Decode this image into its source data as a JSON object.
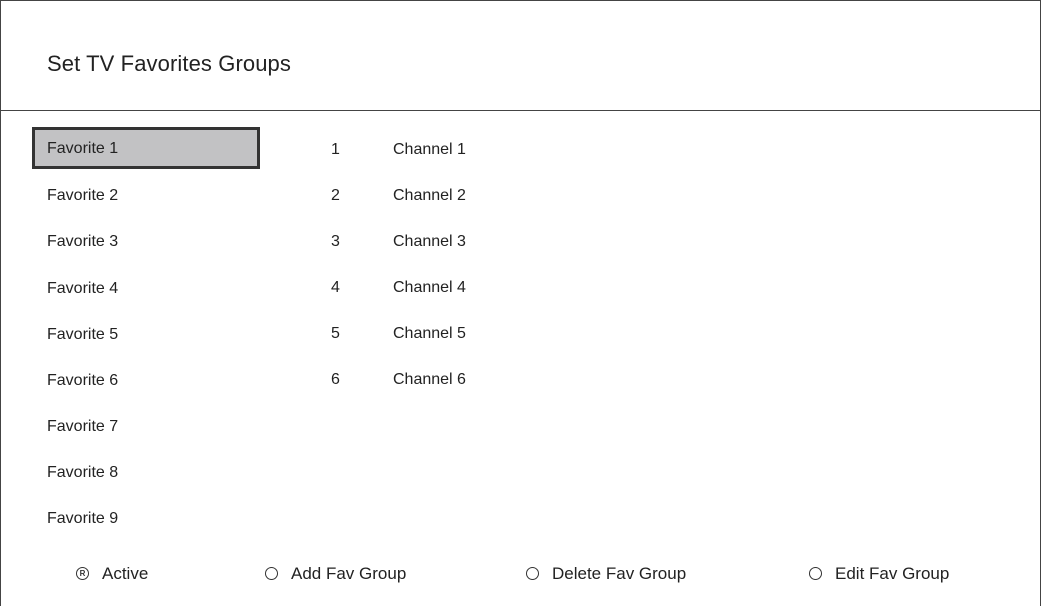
{
  "header": {
    "title": "Set TV Favorites Groups"
  },
  "favorites": [
    {
      "label": "Favorite 1",
      "selected": true
    },
    {
      "label": "Favorite 2",
      "selected": false
    },
    {
      "label": "Favorite 3",
      "selected": false
    },
    {
      "label": "Favorite 4",
      "selected": false
    },
    {
      "label": "Favorite 5",
      "selected": false
    },
    {
      "label": "Favorite 6",
      "selected": false
    },
    {
      "label": "Favorite 7",
      "selected": false
    },
    {
      "label": "Favorite 8",
      "selected": false
    },
    {
      "label": "Favorite 9",
      "selected": false
    }
  ],
  "channels": [
    {
      "number": "1",
      "name": "Channel 1"
    },
    {
      "number": "2",
      "name": "Channel 2"
    },
    {
      "number": "3",
      "name": "Channel 3"
    },
    {
      "number": "4",
      "name": "Channel 4"
    },
    {
      "number": "5",
      "name": "Channel 5"
    },
    {
      "number": "6",
      "name": "Channel 6"
    }
  ],
  "footer": {
    "active": {
      "label": "Active",
      "icon": "remote-r-button-icon"
    },
    "add": {
      "label": "Add Fav Group",
      "icon": "radio-circle-icon"
    },
    "delete": {
      "label": "Delete Fav Group",
      "icon": "radio-circle-icon"
    },
    "edit": {
      "label": "Edit Fav Group",
      "icon": "radio-circle-icon"
    }
  },
  "colors": {
    "selected_bg": "#c2c2c4",
    "selected_border": "#333333",
    "line": "#444444"
  }
}
